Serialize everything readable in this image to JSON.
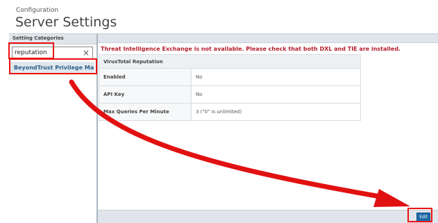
{
  "header": {
    "breadcrumb": "Configuration",
    "title": "Server Settings"
  },
  "sidebar": {
    "header": "Setting Categories",
    "search": {
      "value": "reputation"
    },
    "results": [
      "BeyondTrust Privilege Man..."
    ]
  },
  "main": {
    "warning": "Threat Intelligence Exchange is not available. Please check that both DXL and TIE are installed.",
    "section_title": "VirusTotal Reputation",
    "rows": [
      {
        "label": "Enabled",
        "value": "No"
      },
      {
        "label": "API Key",
        "value": "No"
      },
      {
        "label": "Max Queries Per Minute",
        "value": "3 (\"0\" is unlimited)"
      }
    ]
  },
  "footer": {
    "edit_label": "Edit"
  },
  "colors": {
    "highlight": "#e11111",
    "warning": "#b51e2e",
    "accent": "#1e6aa8"
  }
}
